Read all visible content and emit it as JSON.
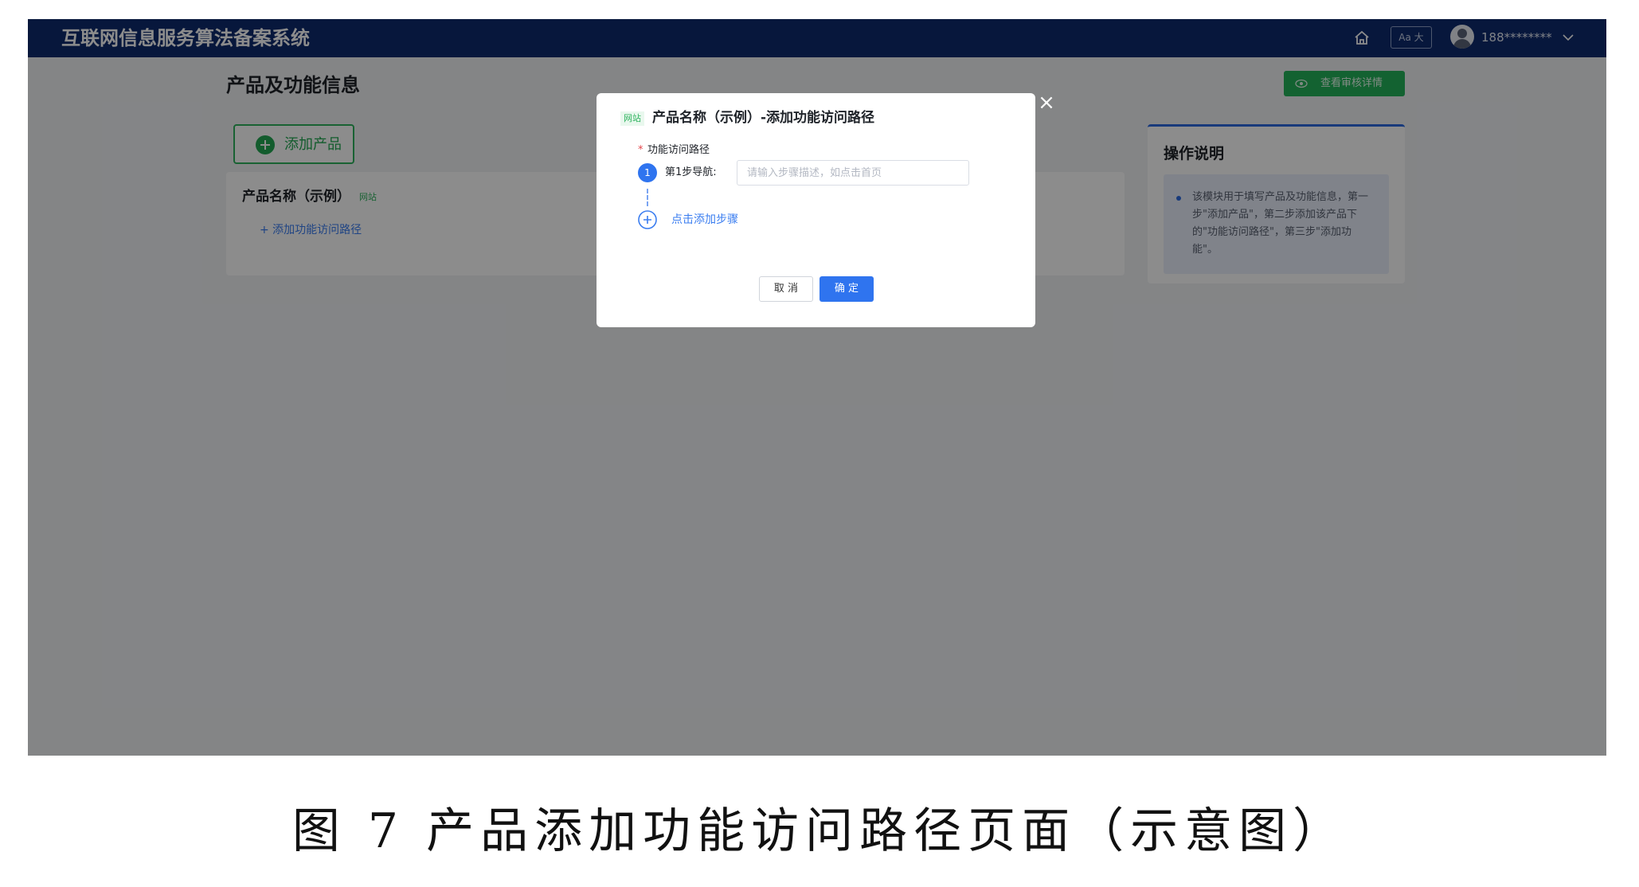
{
  "header": {
    "app_title": "互联网信息服务算法备案系统",
    "font_size_toggle": "Aa 大",
    "user_name": "188********"
  },
  "page": {
    "title": "产品及功能信息",
    "review_button": "查看审核详情",
    "add_product_button": "添加产品"
  },
  "product_card": {
    "name": "产品名称（示例）",
    "tag": "网站",
    "add_path_link": "+ 添加功能访问路径"
  },
  "help": {
    "title": "操作说明",
    "text": "该模块用于填写产品及功能信息，第一步\"添加产品\"，第二步添加该产品下的\"功能访问路径\"，第三步\"添加功能\"。"
  },
  "modal": {
    "tag": "网站",
    "title": "产品名称（示例）-添加功能访问路径",
    "required_mark": "*",
    "field_label": "功能访问路径",
    "step_number": "1",
    "step_label": "第1步导航:",
    "step_placeholder": "请输入步骤描述，如点击首页",
    "add_step_link": "点击添加步骤",
    "cancel": "取 消",
    "confirm": "确 定",
    "close": "×"
  },
  "caption": "图 7  产品添加功能访问路径页面（示意图）",
  "colors": {
    "topbar": "#0e2a6e",
    "accent_blue": "#2f74ef",
    "accent_green": "#24b35a"
  }
}
